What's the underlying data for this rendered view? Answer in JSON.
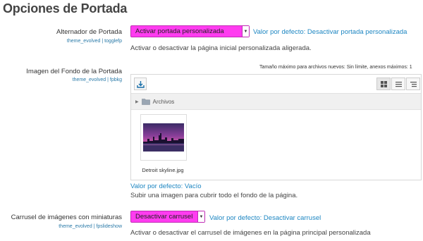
{
  "page": {
    "title": "Opciones de Portada"
  },
  "settings": {
    "toggle": {
      "label": "Alternador de Portada",
      "key": "theme_evolved | togglefp",
      "selected": "Activar portada personalizada",
      "default": "Valor por defecto: Desactivar portada personalizada",
      "description": "Activar o desactivar la página inicial personalizada aligerada."
    },
    "background": {
      "label": "Imagen del Fondo de la Portada",
      "key": "theme_evolved | fpbkg",
      "max_size_note": "Tamaño máximo para archivos nuevos: Sin límite, anexos máximos: 1",
      "folder": "Archivos",
      "file_name": "Detroit skyline.jpg",
      "default": "Valor por defecto: Vacío",
      "description": "Subir una imagen para cubrir todo el fondo de la página."
    },
    "carousel": {
      "label": "Carrusel de imágenes con miniaturas",
      "key": "theme_evolved | fpslideshow",
      "selected": "Desactivar carrusel",
      "default": "Valor por defecto: Desactivar carrusel",
      "description": "Activar o desactivar el carrusel de imágenes en la página principal personalizada"
    }
  },
  "icons": {
    "upload": "download-arrow-icon",
    "grid_view": "grid-view-icon",
    "list_view": "list-view-icon",
    "tree_view": "tree-view-icon",
    "folder": "folder-icon",
    "expand": "triangle-right-icon"
  },
  "colors": {
    "select_bg": "#ff3cf0",
    "link": "#1d86c2"
  }
}
